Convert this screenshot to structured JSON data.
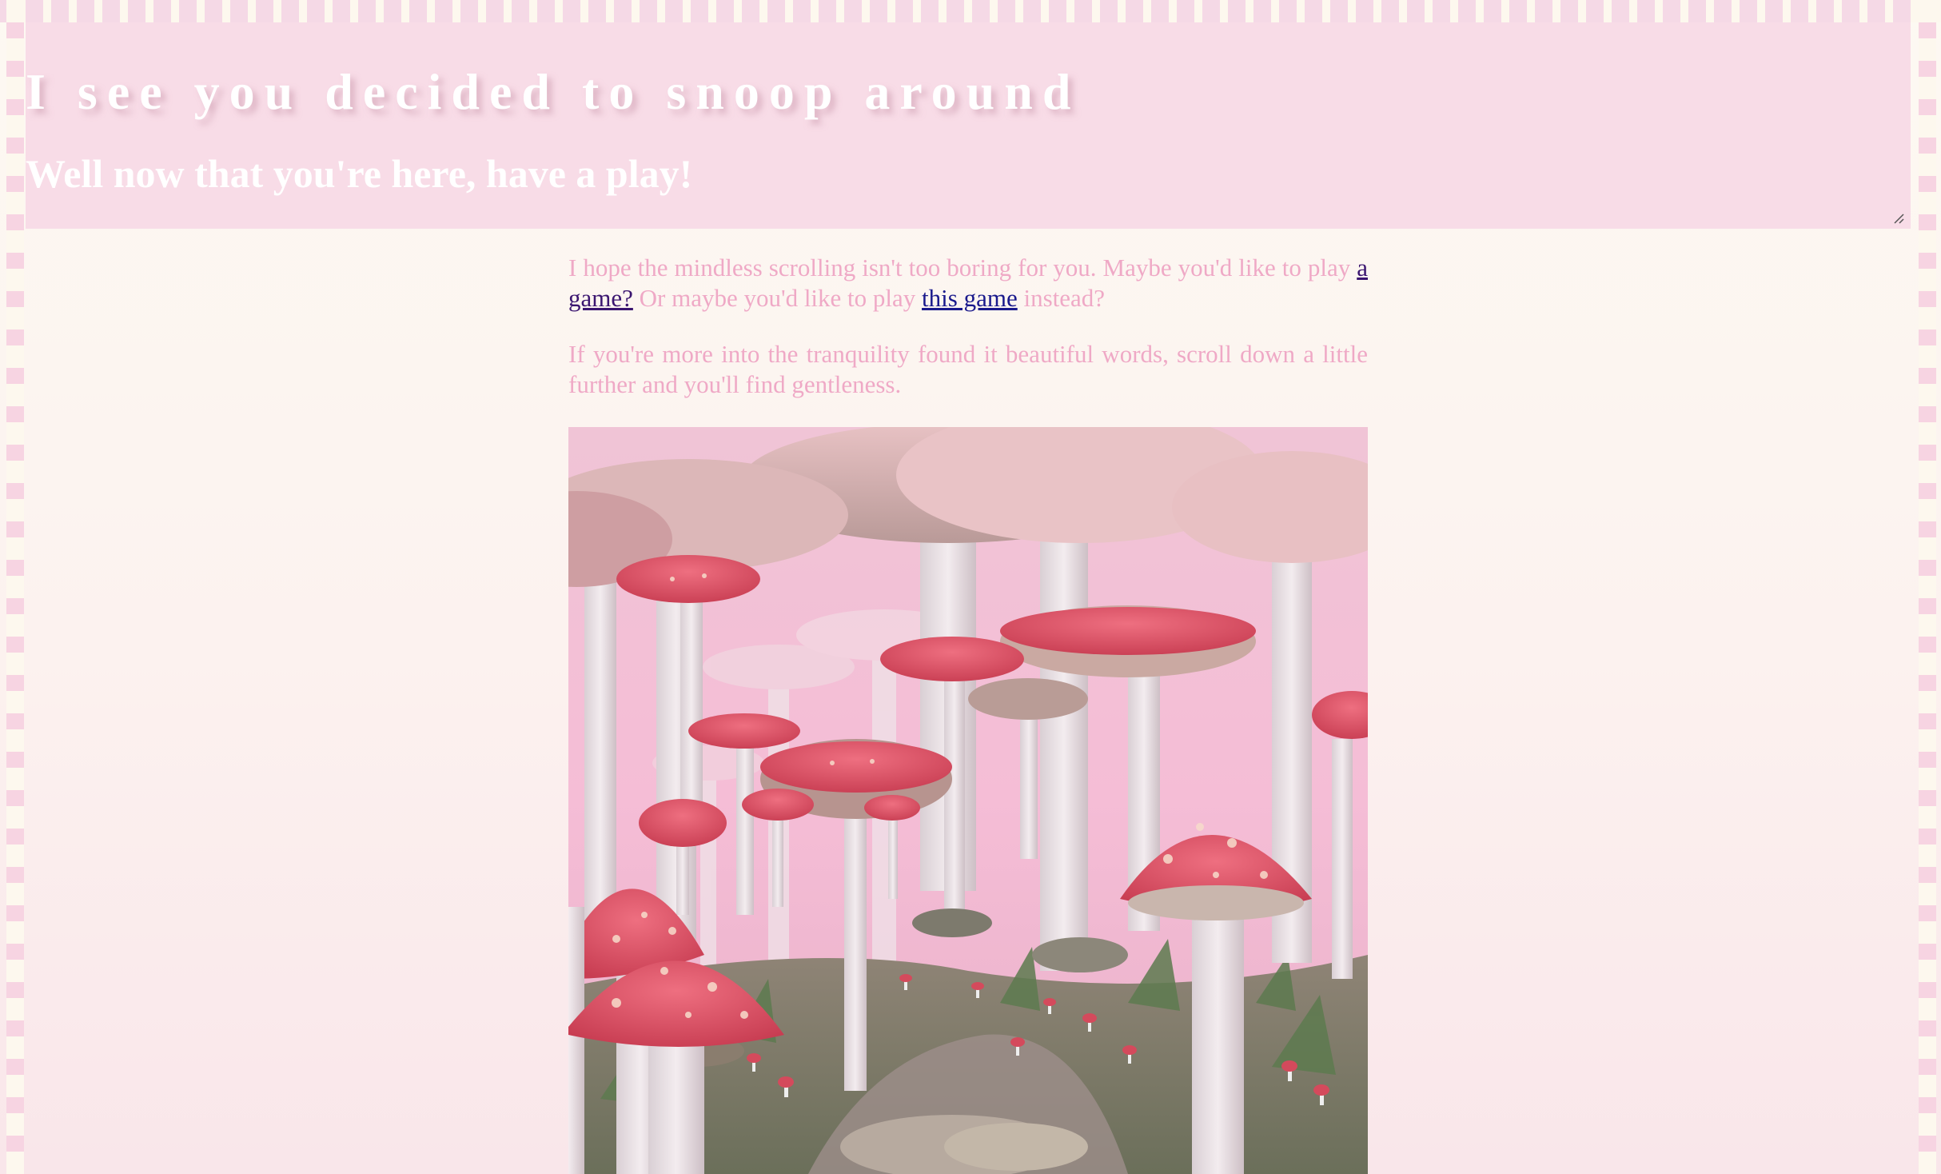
{
  "header": {
    "title": "I see you decided to snoop around",
    "subtitle": "Well now that you're here, have a play!"
  },
  "content": {
    "paragraph1": {
      "text_before_link1": "I hope the mindless scrolling isn't too boring for you. Maybe you'd like to play ",
      "link1": "a game?",
      "text_between": " Or maybe you'd like to play ",
      "link2": "this game",
      "text_after": " instead?"
    },
    "paragraph2": "If you're more into the tranquility found it beautiful words, scroll down a little further and you'll find gentleness."
  },
  "image": {
    "subject": "mushroom-forest-illustration"
  },
  "colors": {
    "header_bg": "#f8dce7",
    "body_text": "#efa9c6",
    "link": "#1a1a8c",
    "visited_link": "#3b1670",
    "mushroom_cap": "#e0566a"
  }
}
